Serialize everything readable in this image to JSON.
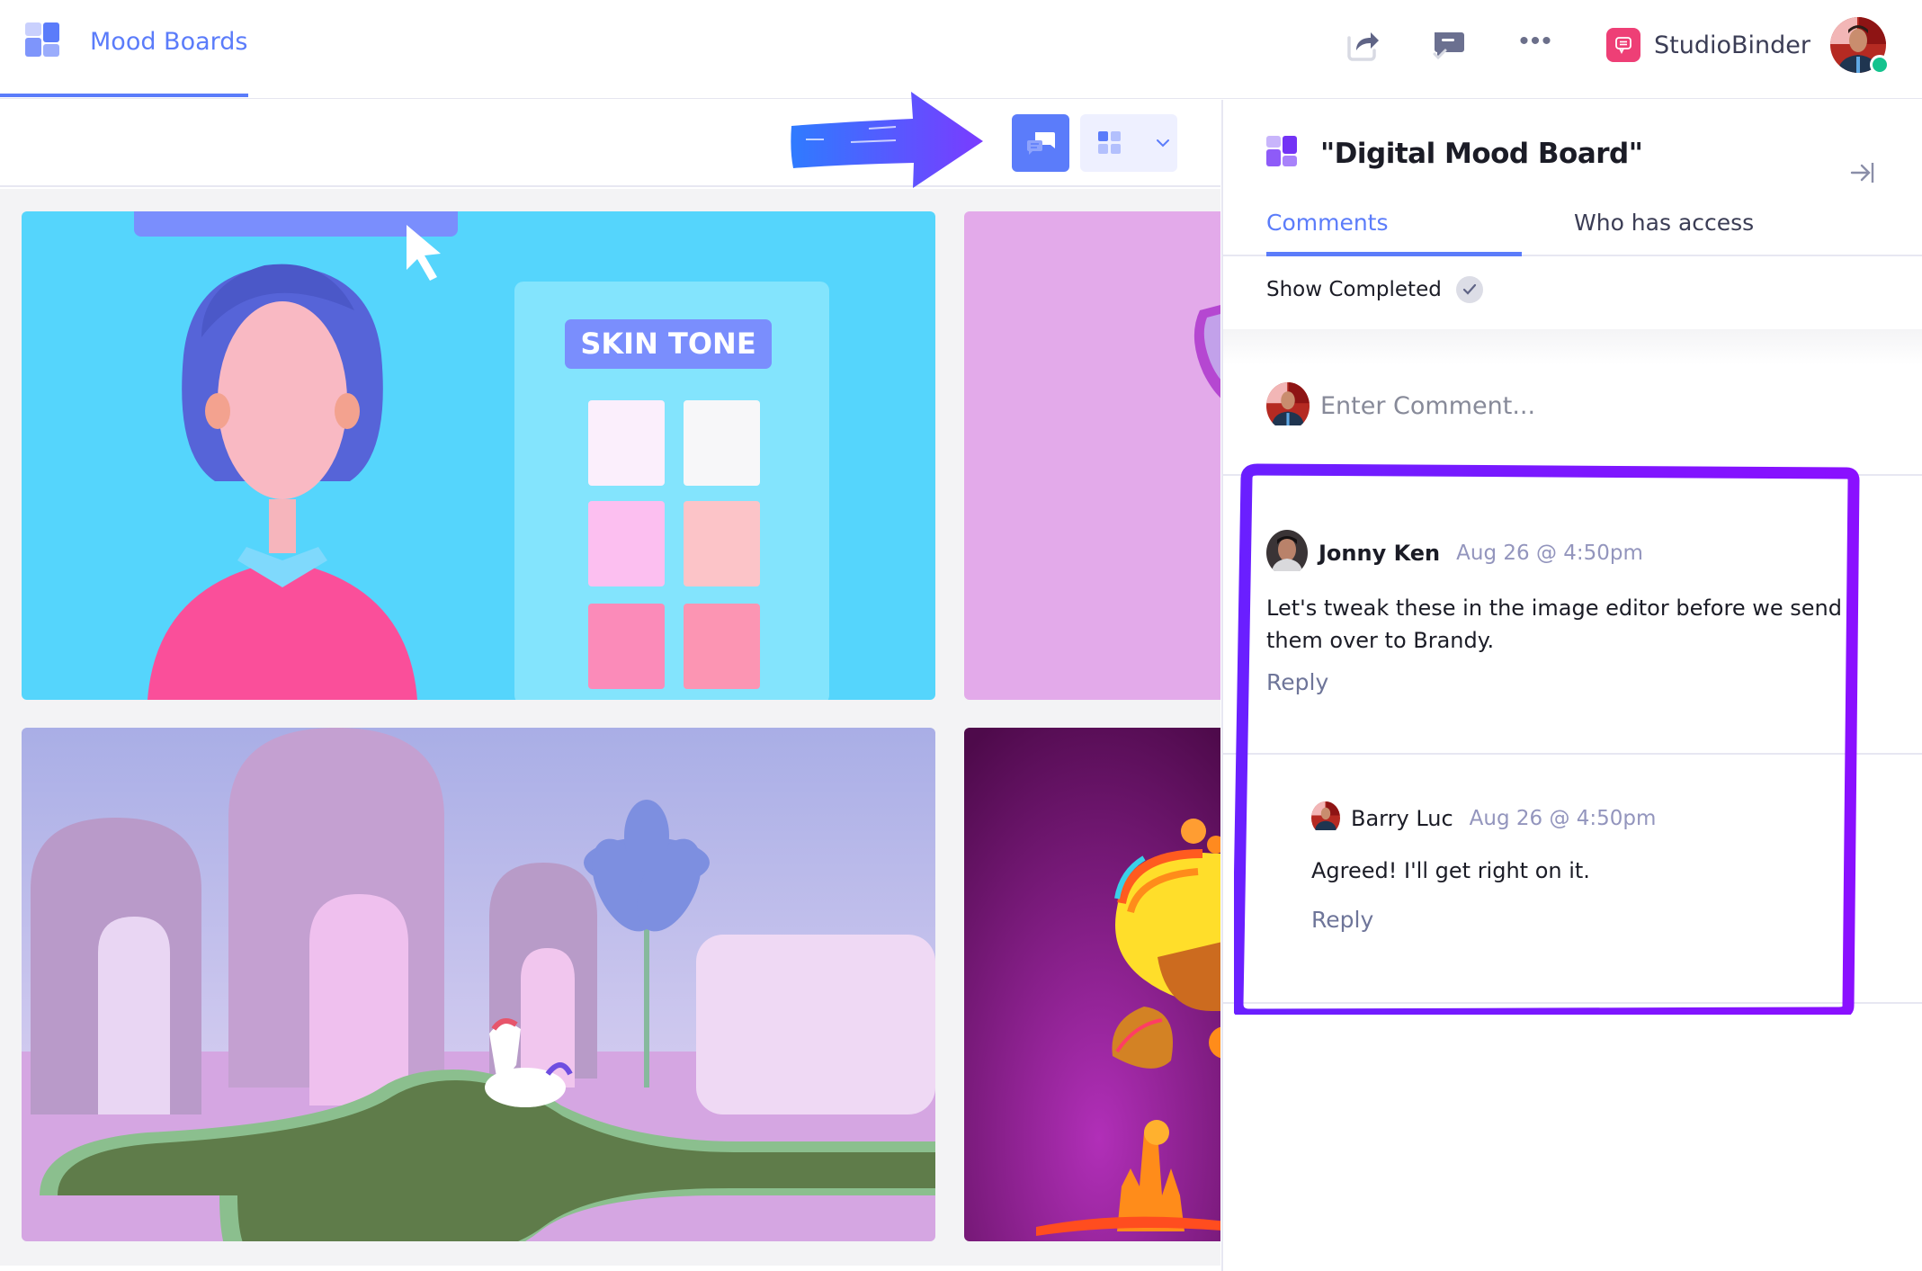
{
  "nav": {
    "app_icon": "mood-board-icon",
    "app_title": "Mood Boards",
    "share_icon": "share-icon",
    "comment_resolve_icon": "comment-check-icon",
    "more_icon": "more-horizontal-icon",
    "more_label": "•••",
    "workspace_logo_icon": "studiobinder-logo-icon",
    "workspace_name": "StudioBinder",
    "user_avatar": "user-avatar",
    "online_status": "online"
  },
  "toolbar": {
    "comments_toggle_icon": "comments-icon",
    "layout_icon": "grid-layout-icon",
    "layout_dropdown_icon": "chevron-down-icon",
    "annotation": "arrow pointing to comments button",
    "accent_color": "#5b7cfa"
  },
  "board": {
    "images": [
      {
        "name": "skin-tone-character",
        "text": "SKIN TONE"
      },
      {
        "name": "pink-abstract"
      },
      {
        "name": "arches-pool-unicorn"
      },
      {
        "name": "psychedelic-mushrooms"
      }
    ]
  },
  "panel": {
    "title": "\"Digital Mood Board\"",
    "collapse_icon": "collapse-right-icon",
    "tabs": [
      {
        "label": "Comments",
        "active": true
      },
      {
        "label": "Who has access",
        "active": false
      }
    ],
    "show_completed_label": "Show Completed",
    "show_completed_checked": true,
    "comment_input": {
      "placeholder": "Enter Comment...",
      "value": ""
    },
    "comments": [
      {
        "author": "Jonny Ken",
        "time": "Aug 26 @ 4:50pm",
        "body": "Let's tweak these in the image editor before we send them over to Brandy.",
        "reply_label": "Reply"
      },
      {
        "author": "Barry Luc",
        "time": "Aug 26 @ 4:50pm",
        "body": "Agreed! I'll get right on it.",
        "reply_label": "Reply",
        "is_reply": true
      }
    ],
    "highlight_color": "#7a1bff"
  }
}
